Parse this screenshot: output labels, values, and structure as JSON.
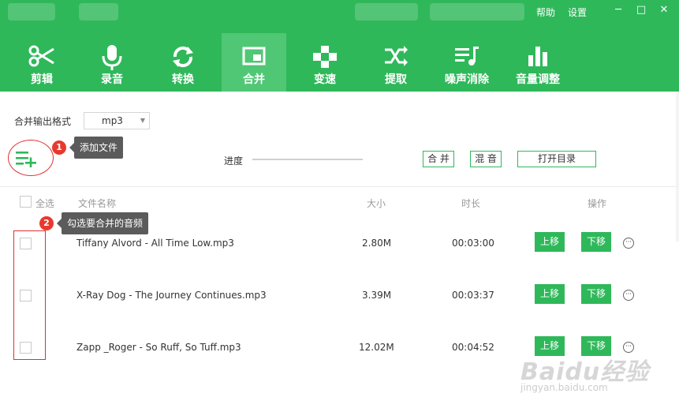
{
  "window": {
    "help_label": "帮助",
    "settings_label": "设置",
    "minimize": "─",
    "maximize": "□",
    "close": "✕"
  },
  "toolbar": {
    "tools": [
      {
        "id": "cut",
        "label": "剪辑",
        "icon": "scissors-icon"
      },
      {
        "id": "record",
        "label": "录音",
        "icon": "microphone-icon"
      },
      {
        "id": "convert",
        "label": "转换",
        "icon": "refresh-icon"
      },
      {
        "id": "merge",
        "label": "合并",
        "icon": "merge-window-icon",
        "active": true
      },
      {
        "id": "speed",
        "label": "变速",
        "icon": "gamepad-icon"
      },
      {
        "id": "extract",
        "label": "提取",
        "icon": "shuffle-icon"
      },
      {
        "id": "denoise",
        "label": "噪声消除",
        "icon": "music-list-icon"
      },
      {
        "id": "volume",
        "label": "音量调整",
        "icon": "bars-icon"
      }
    ]
  },
  "options": {
    "format_label": "合并输出格式",
    "format_value": "mp3"
  },
  "actions": {
    "add_tip": "添加文件",
    "progress_label": "进度",
    "progress": 0,
    "merge_btn": "合 并",
    "mix_btn": "混 音",
    "open_dir_btn": "打开目录"
  },
  "annotations": {
    "step1": "1",
    "step2": "2",
    "select_tip": "勾选要合并的音频"
  },
  "table": {
    "headers": {
      "select_all": "全选",
      "name": "文件名称",
      "size": "大小",
      "duration": "时长",
      "actions": "操作"
    },
    "move_up": "上移",
    "move_down": "下移",
    "more": "···",
    "rows": [
      {
        "name": "Tiffany Alvord - All Time Low.mp3",
        "size": "2.80M",
        "duration": "00:03:00"
      },
      {
        "name": "X-Ray Dog - The Journey Continues.mp3",
        "size": "3.39M",
        "duration": "00:03:37"
      },
      {
        "name": "Zapp _Roger - So Ruff, So Tuff.mp3",
        "size": "12.02M",
        "duration": "00:04:52"
      }
    ]
  },
  "watermark": {
    "brand": "Baidu经验",
    "url": "jingyan.baidu.com"
  },
  "colors": {
    "brand_green": "#2fb85a",
    "active_tab": "#50c775",
    "annotation_red": "#e8392f"
  }
}
